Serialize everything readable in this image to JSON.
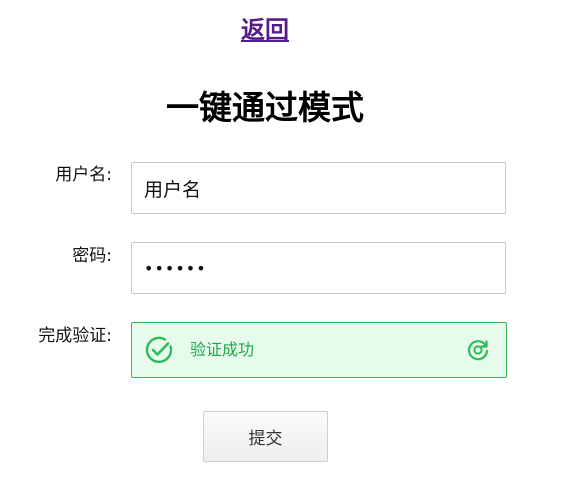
{
  "nav": {
    "back_label": "返回"
  },
  "page": {
    "title": "一键通过模式"
  },
  "form": {
    "username": {
      "label": "用户名:",
      "value": "用户名"
    },
    "password": {
      "label": "密码:",
      "value": "••••••"
    },
    "captcha": {
      "label": "完成验证:",
      "status_text": "验证成功",
      "status_icon": "check-circle-icon",
      "refresh_icon": "refresh-icon",
      "success_color": "#2fbb57",
      "success_bg": "#e6fbec"
    },
    "submit_label": "提交"
  }
}
